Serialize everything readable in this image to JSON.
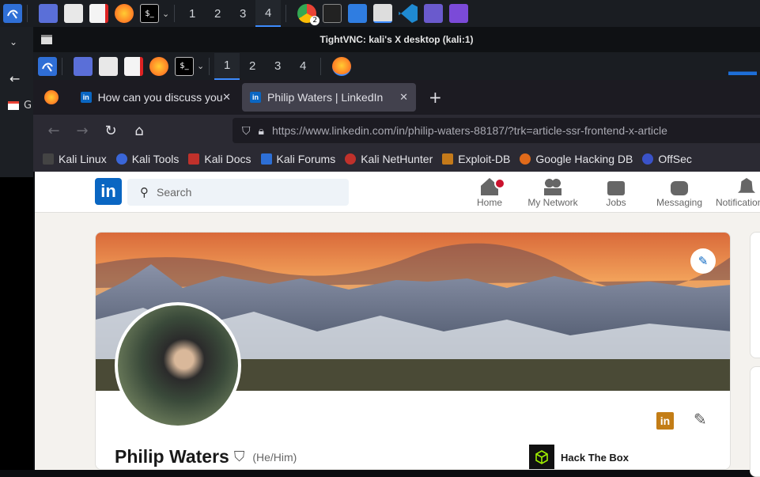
{
  "outer_taskbar": {
    "workspaces": [
      "1",
      "2",
      "3",
      "4"
    ],
    "active_workspace": "4",
    "chrome_badge": "2"
  },
  "vnc": {
    "title": "TightVNC: kali's X desktop (kali:1)"
  },
  "inner_taskbar": {
    "workspaces": [
      "1",
      "2",
      "3",
      "4"
    ],
    "active_workspace": "1"
  },
  "browser": {
    "tabs": [
      {
        "label": "How can you discuss your"
      },
      {
        "label": "Philip Waters | LinkedIn"
      }
    ],
    "new_tab": "+",
    "url": "https://www.linkedin.com/in/philip-waters-88187/?trk=article-ssr-frontend-x-article",
    "bookmarks": [
      "Kali Linux",
      "Kali Tools",
      "Kali Docs",
      "Kali Forums",
      "Kali NetHunter",
      "Exploit-DB",
      "Google Hacking DB",
      "OffSec"
    ]
  },
  "host_sidebar": {
    "mail_label": "G"
  },
  "linkedin": {
    "logo": "in",
    "search_placeholder": "Search",
    "nav": [
      "Home",
      "My Network",
      "Jobs",
      "Messaging",
      "Notifications"
    ],
    "profile": {
      "name": "Philip Waters",
      "pronouns": "(He/Him)",
      "company": "Hack The Box"
    }
  },
  "colors": {
    "linkedin_blue": "#0a66c2",
    "firefox_url_bg": "#1c1b22",
    "active_accent": "#3d8bfd"
  }
}
